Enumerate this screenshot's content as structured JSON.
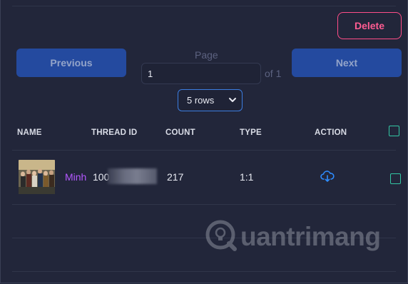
{
  "toolbar": {
    "delete_label": "Delete"
  },
  "pagination": {
    "previous_label": "Previous",
    "next_label": "Next",
    "page_label": "Page",
    "page_value": "1",
    "of_text": "of 1",
    "rows_selected": "5 rows"
  },
  "table": {
    "headers": [
      "NAME",
      "THREAD ID",
      "COUNT",
      "TYPE",
      "ACTION"
    ],
    "rows": [
      {
        "name": "Minh",
        "thread_id": "100",
        "count": "217",
        "type": "1:1",
        "action_icon": "cloud-download-icon"
      }
    ]
  },
  "watermark": {
    "text": "uantrimang"
  },
  "colors": {
    "background": "#22263a",
    "primary_button": "#244a9f",
    "delete_accent": "#ff5c92",
    "name_accent": "#b458ff",
    "checkbox": "#33c7a4",
    "select_border": "#3c7de0"
  }
}
